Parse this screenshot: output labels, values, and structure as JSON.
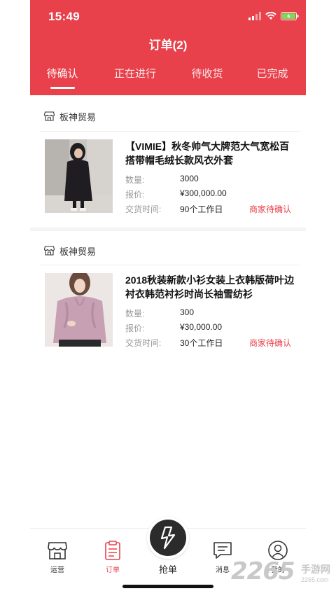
{
  "status_bar": {
    "time": "15:49"
  },
  "header": {
    "title": "订单(2)"
  },
  "tabs": [
    {
      "label": "待确认",
      "active": true
    },
    {
      "label": "正在进行",
      "active": false
    },
    {
      "label": "待收货",
      "active": false
    },
    {
      "label": "已完成",
      "active": false
    }
  ],
  "orders": [
    {
      "shop_name": "板神贸易",
      "product_title": "【VIMIE】秋冬帅气大牌范大气宽松百搭带帽毛绒长款风衣外套",
      "quantity_label": "数量:",
      "quantity": "3000",
      "price_label": "报价:",
      "price": "¥300,000.00",
      "delivery_label": "交货时间:",
      "delivery": "90个工作日",
      "status": "商家待确认"
    },
    {
      "shop_name": "板神贸易",
      "product_title": "2018秋装新款小衫女装上衣韩版荷叶边衬衣韩范衬衫时尚长袖雪纺衫",
      "quantity_label": "数量:",
      "quantity": "300",
      "price_label": "报价:",
      "price": "¥30,000.00",
      "delivery_label": "交货时间:",
      "delivery": "30个工作日",
      "status": "商家待确认"
    }
  ],
  "bottom_nav": {
    "items": [
      {
        "label": "运营",
        "icon": "store-icon"
      },
      {
        "label": "订单",
        "icon": "clipboard-icon",
        "active": true
      },
      {
        "label": "抢单",
        "icon": "lightning-icon"
      },
      {
        "label": "消息",
        "icon": "message-icon"
      },
      {
        "label": "我的",
        "icon": "user-icon"
      }
    ]
  },
  "watermark": {
    "number": "2265",
    "text": "手游网",
    "url": "2265.com"
  },
  "colors": {
    "accent": "#e8414b",
    "dark": "#2b2b2b"
  }
}
